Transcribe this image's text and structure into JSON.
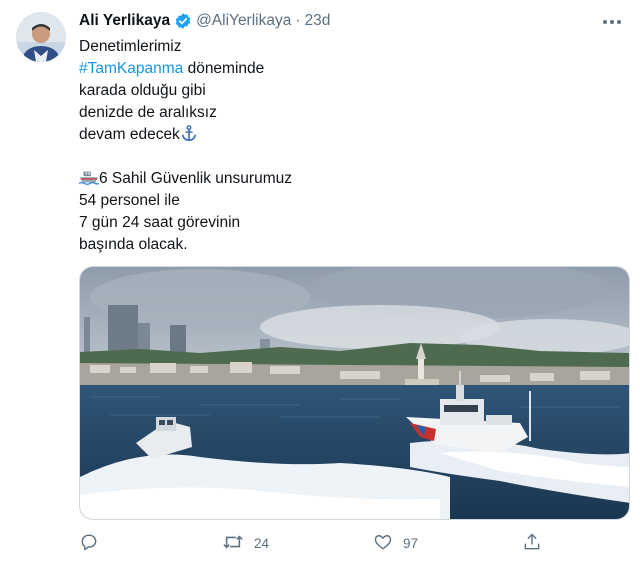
{
  "author": {
    "name": "Ali Yerlikaya",
    "handle": "@AliYerlikaya",
    "separator": "·",
    "time": "23d"
  },
  "tweet": {
    "line1": "Denetimlerimiz",
    "hashtag": "#TamKapanma",
    "line2_rest": " döneminde",
    "line3": "karada olduğu gibi",
    "line4": "denizde de aralıksız",
    "line5": "devam edecek",
    "line6": "6 Sahil Güvenlik unsurumuz",
    "line7": "54 personel ile",
    "line8": "7 gün 24 saat görevinin",
    "line9": "başında olacak."
  },
  "actions": {
    "retweet_count": "24",
    "like_count": "97"
  },
  "icons": {
    "verified": "verified-badge-icon",
    "more": "more-icon",
    "anchor": "anchor-emoji-icon",
    "ship": "ship-emoji-icon",
    "reply": "reply-icon",
    "retweet": "retweet-icon",
    "like": "like-icon",
    "share": "share-icon"
  },
  "colors": {
    "link": "#1b95e0",
    "verified": "#1da1f2",
    "muted": "#5b7083"
  }
}
